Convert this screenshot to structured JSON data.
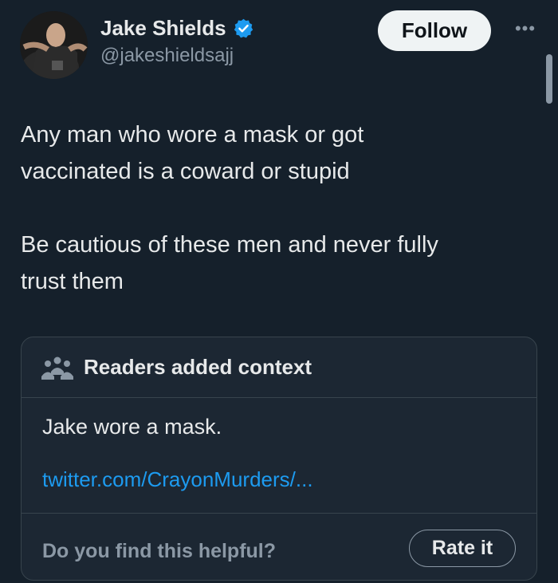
{
  "author": {
    "name": "Jake Shields",
    "handle": "@jakeshieldsajj",
    "verified": true,
    "avatar_icon": "profile-photo"
  },
  "header": {
    "follow_label": "Follow",
    "more_icon": "ellipsis-icon"
  },
  "tweet": {
    "text": "Any man who wore a mask or got\nvaccinated is a coward or stupid\n\nBe cautious of these men and never fully\ntrust them"
  },
  "community_note": {
    "title": "Readers added context",
    "title_icon": "people-icon",
    "body": "Jake wore a mask.",
    "link": "twitter.com/CrayonMurders/...",
    "helpful_question": "Do you find this helpful?",
    "rate_label": "Rate it"
  },
  "colors": {
    "background": "#15202b",
    "card_background": "#1c2733",
    "text_primary": "#e7e9ea",
    "text_secondary": "#8b98a5",
    "accent_blue": "#1d9bf0",
    "border": "#38444d"
  }
}
